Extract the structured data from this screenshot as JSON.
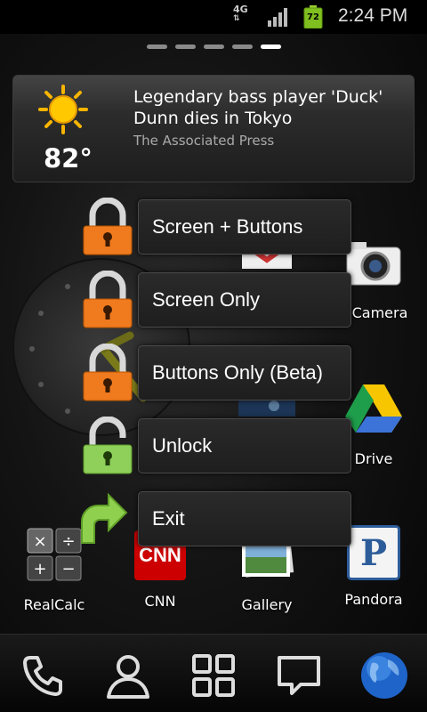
{
  "status_bar": {
    "network": "4G",
    "battery_level": "72",
    "time": "2:24 PM"
  },
  "home_pages": {
    "count": 5,
    "active_index": 4
  },
  "widget": {
    "temperature": "82°",
    "weather_icon": "sun-icon",
    "headline": "Legendary bass player 'Duck' Dunn dies in Tokyo",
    "source": "The Associated Press"
  },
  "menu": {
    "items": [
      {
        "label": "Screen + Buttons",
        "icon": "locked-orange-padlock-icon"
      },
      {
        "label": "Screen Only",
        "icon": "locked-orange-padlock-icon"
      },
      {
        "label": "Buttons Only (Beta)",
        "icon": "locked-orange-padlock-icon"
      },
      {
        "label": "Unlock",
        "icon": "unlocked-green-padlock-icon"
      },
      {
        "label": "Exit",
        "icon": "green-exit-arrow-icon"
      }
    ]
  },
  "apps": {
    "camera": "Camera",
    "drive": "Drive",
    "realcalc": "RealCalc",
    "cnn": "CNN",
    "gallery": "Gallery",
    "pandora": "Pandora",
    "cnn_icon_text": "CNN",
    "pandora_icon_text": "P"
  },
  "dock": {
    "items": [
      "phone-icon",
      "contacts-icon",
      "app-drawer-icon",
      "messaging-icon",
      "browser-globe-icon"
    ]
  }
}
